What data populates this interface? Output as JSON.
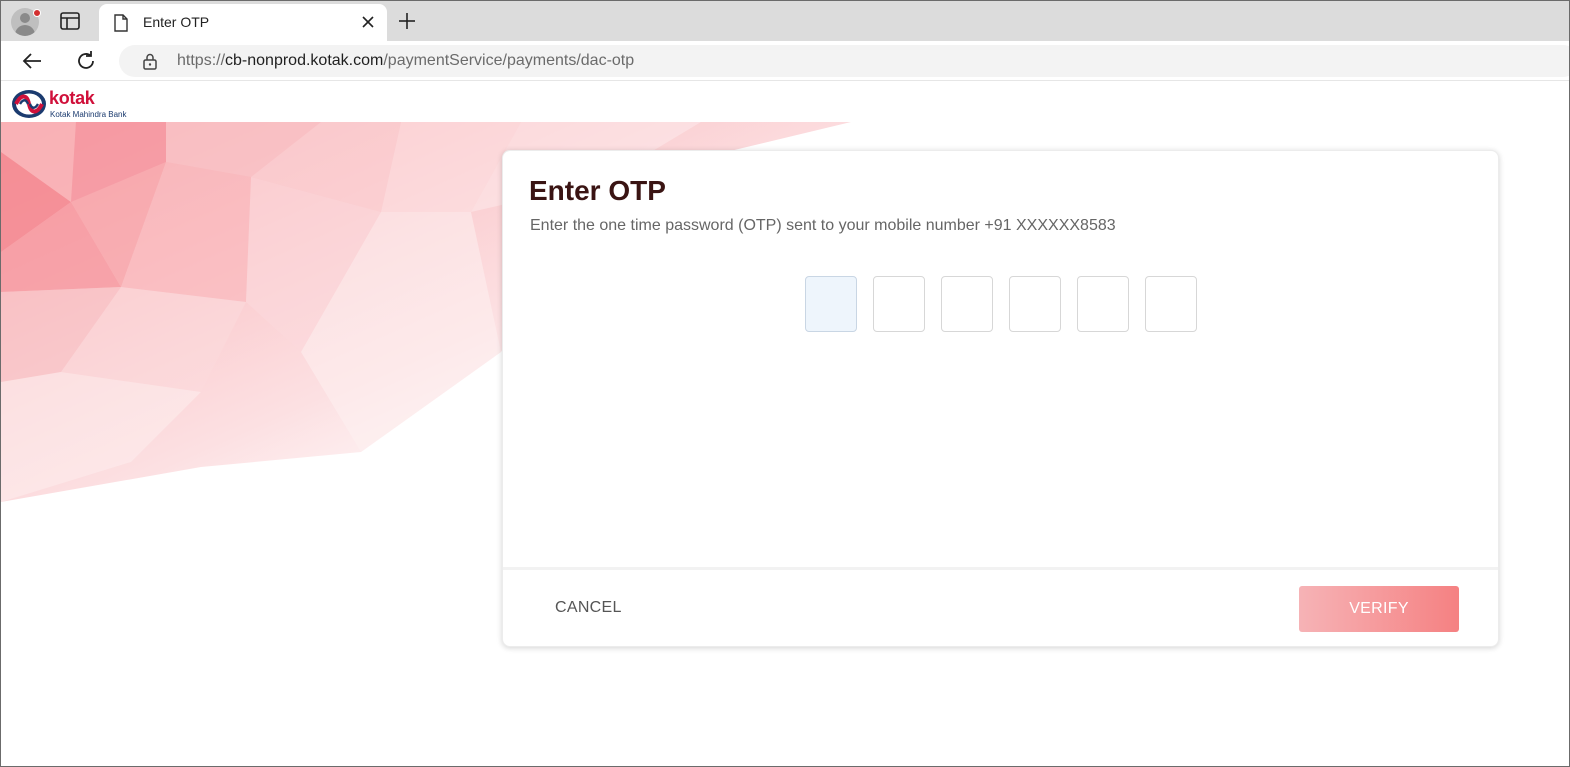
{
  "browser": {
    "tab_title": "Enter OTP",
    "url_prefix": "https://",
    "url_host": "cb-nonprod.kotak.com",
    "url_path": "/paymentService/payments/dac-otp"
  },
  "brand": {
    "name": "kotak",
    "tagline": "Kotak Mahindra Bank",
    "accent": "#d0103a",
    "navy": "#1b3b6f"
  },
  "otp_dialog": {
    "title": "Enter OTP",
    "subtitle": "Enter the one time password (OTP) sent to your mobile number +91 XXXXXX8583",
    "digits": [
      "",
      "",
      "",
      "",
      "",
      ""
    ],
    "cancel_label": "CANCEL",
    "verify_label": "VERIFY"
  },
  "icons": {
    "profile": "profile-avatar-icon",
    "tab_actions": "tab-actions-icon",
    "page": "page-icon",
    "close": "close-icon",
    "new_tab": "plus-icon",
    "back": "back-arrow-icon",
    "reload": "reload-icon",
    "lock": "lock-icon"
  }
}
